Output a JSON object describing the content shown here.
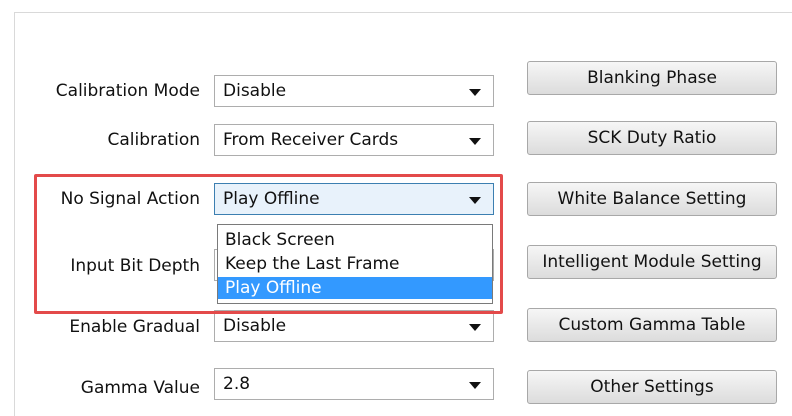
{
  "rows": [
    {
      "label": "Calibration Mode",
      "value": "Disable"
    },
    {
      "label": "Calibration",
      "value": "From Receiver Cards"
    },
    {
      "label": "No Signal Action",
      "value": "Play Offline"
    },
    {
      "label": "Input Bit Depth",
      "value": ""
    },
    {
      "label": "Enable Gradual",
      "value": "Disable"
    },
    {
      "label": "Gamma Value",
      "value": "2.8"
    }
  ],
  "buttons": [
    "Blanking Phase",
    "SCK Duty Ratio",
    "White Balance Setting",
    "Intelligent Module Setting",
    "Custom Gamma Table",
    "Other Settings"
  ],
  "dropdown": {
    "options": [
      "Black Screen",
      "Keep the Last Frame",
      "Play Offline"
    ],
    "selected_index": 2
  },
  "colors": {
    "highlight_border": "#e34a4a",
    "selection": "#3399ff"
  }
}
